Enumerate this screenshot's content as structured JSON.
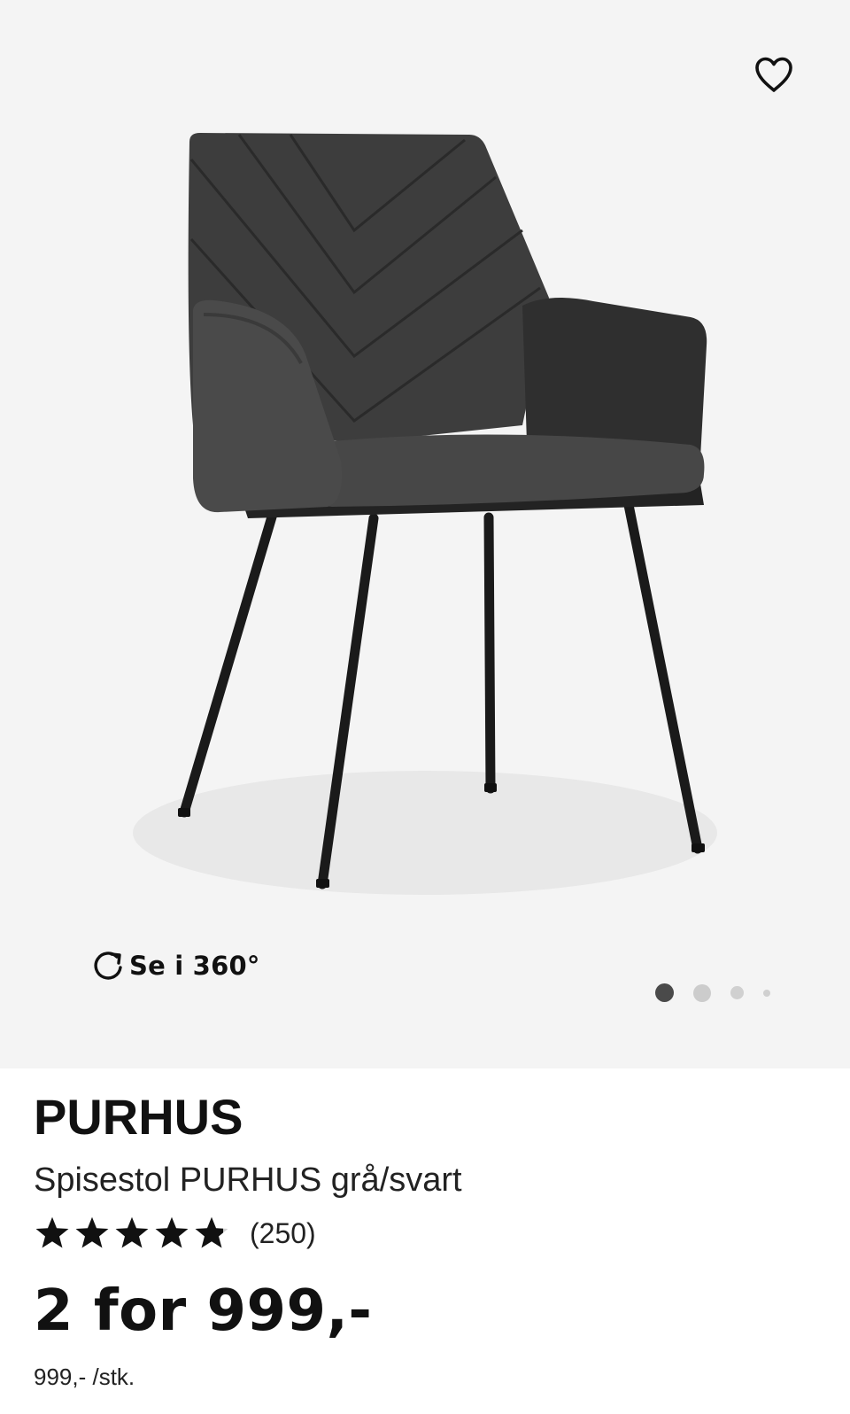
{
  "gallery": {
    "favorite_icon": "heart-outline-icon",
    "spin": {
      "icon": "rotate-icon",
      "label": "Se i 360°"
    },
    "pagination": {
      "total": 4,
      "active": 1
    }
  },
  "product": {
    "brand": "PURHUS",
    "subtitle": "Spisestol PURHUS grå/svart",
    "rating": {
      "stars": 4.8,
      "max": 5,
      "count_label": "(250)"
    },
    "price": "2 for 999,-",
    "unit_price": "999,- /stk."
  },
  "colors": {
    "gallery_bg": "#f4f4f4",
    "text": "#111111",
    "dot_active": "#4a4a4a",
    "dot_inactive": "#cccccc"
  }
}
